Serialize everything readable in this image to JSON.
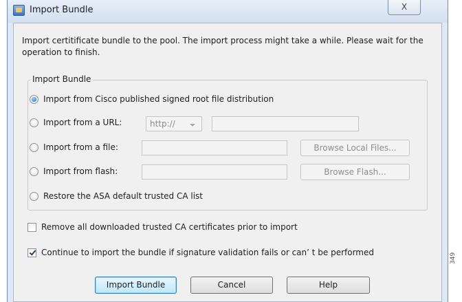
{
  "window": {
    "title": "Import Bundle",
    "close_glyph": "X",
    "title_icon": "certificate-bundle-icon"
  },
  "intro_text": "Import certitificate bundle to the pool. The import process might take a while. Please wait for the operation to finish.",
  "import_group": {
    "legend": "Import Bundle",
    "options": [
      {
        "label": "Import from Cisco published signed root file distribution",
        "selected": true
      },
      {
        "label": "Import from a URL:",
        "selected": false
      },
      {
        "label": "Import from a file:",
        "selected": false
      },
      {
        "label": "Import from flash:",
        "selected": false
      },
      {
        "label": "Restore the ASA default trusted CA list",
        "selected": false
      }
    ],
    "url_protocol": "http://",
    "url_value": "",
    "file_value": "",
    "flash_value": "",
    "browse_local_label": "Browse Local Files...",
    "browse_flash_label": "Browse Flash..."
  },
  "checkboxes": [
    {
      "label": "Remove all downloaded trusted CA certificates prior to import",
      "checked": false
    },
    {
      "label": "Continue to import the bundle if signature validation fails or can’ t be performed",
      "checked": true
    }
  ],
  "buttons": {
    "import": "Import Bundle",
    "cancel": "Cancel",
    "help": "Help"
  },
  "side_id": "349"
}
